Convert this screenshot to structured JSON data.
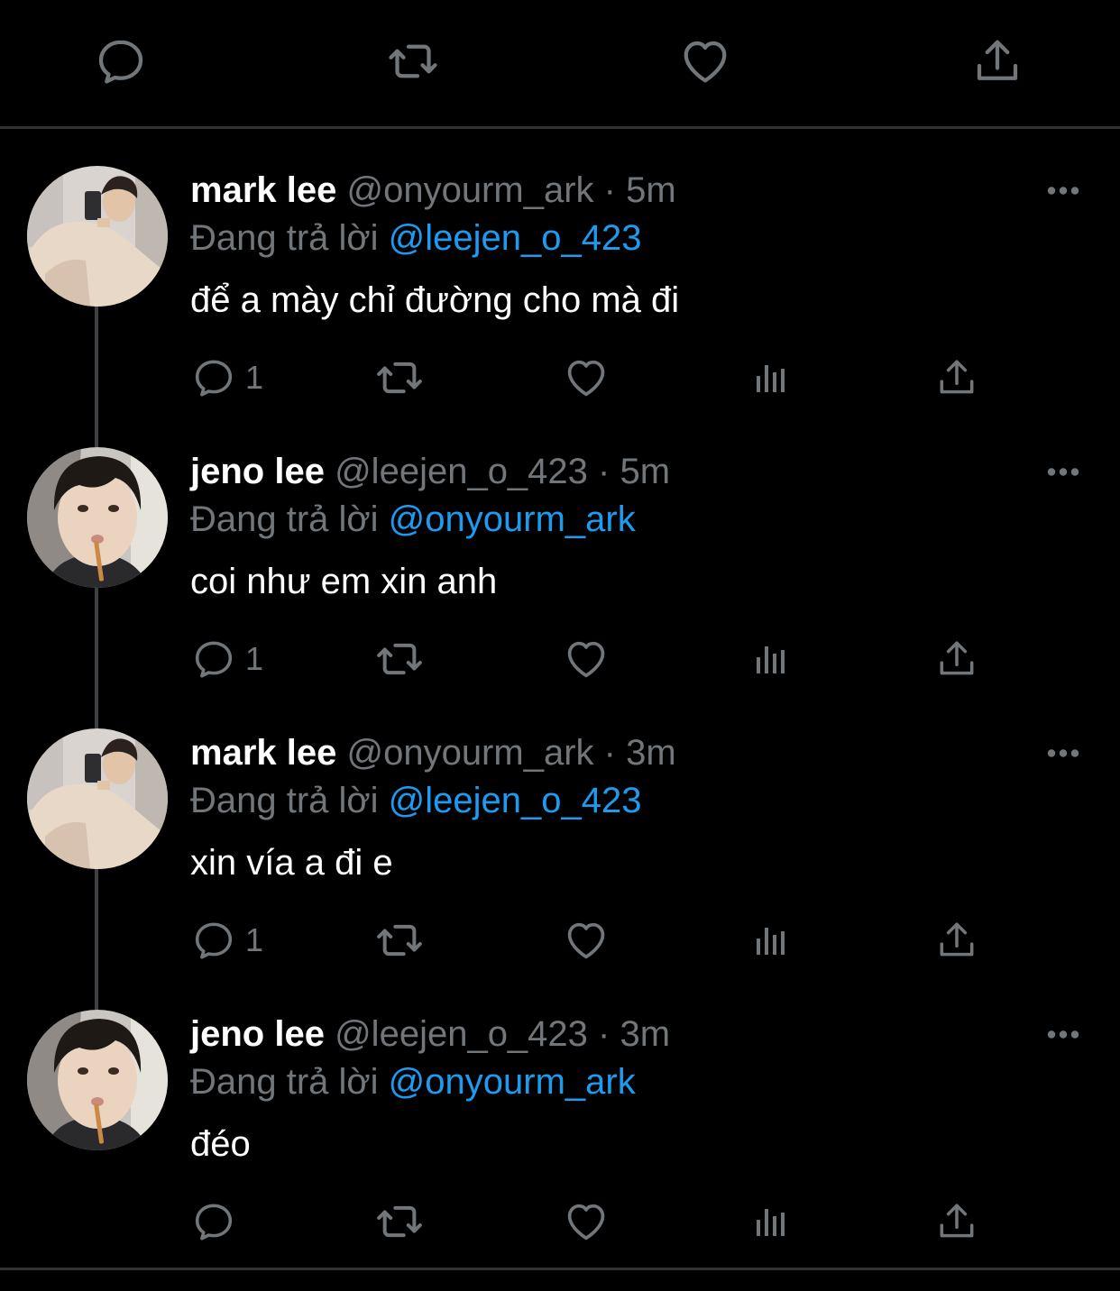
{
  "colors": {
    "background": "#000000",
    "divider": "#2f3336",
    "muted": "#71767b",
    "text": "#ffffff",
    "mention": "#1d9bf0"
  },
  "top_actions": [
    "reply-icon",
    "retweet-icon",
    "like-icon",
    "share-icon"
  ],
  "tweets": [
    {
      "name": "mark lee",
      "handle": "@onyourm_ark",
      "sep": "·",
      "time": "5m",
      "reply_prefix": "Đang trả lời",
      "reply_to": "@leejen_o_423",
      "text": "để a mày chỉ đường cho mà đi",
      "reply_count": "1",
      "avatar": "avatar-mark"
    },
    {
      "name": "jeno lee",
      "handle": "@leejen_o_423",
      "sep": "·",
      "time": "5m",
      "reply_prefix": "Đang trả lời",
      "reply_to": "@onyourm_ark",
      "text": "coi như em xin anh",
      "reply_count": "1",
      "avatar": "avatar-jeno"
    },
    {
      "name": "mark lee",
      "handle": "@onyourm_ark",
      "sep": "·",
      "time": "3m",
      "reply_prefix": "Đang trả lời",
      "reply_to": "@leejen_o_423",
      "text": "xin vía a đi e",
      "reply_count": "1",
      "avatar": "avatar-mark"
    },
    {
      "name": "jeno lee",
      "handle": "@leejen_o_423",
      "sep": "·",
      "time": "3m",
      "reply_prefix": "Đang trả lời",
      "reply_to": "@onyourm_ark",
      "text": "đéo",
      "reply_count": "",
      "avatar": "avatar-jeno"
    }
  ]
}
